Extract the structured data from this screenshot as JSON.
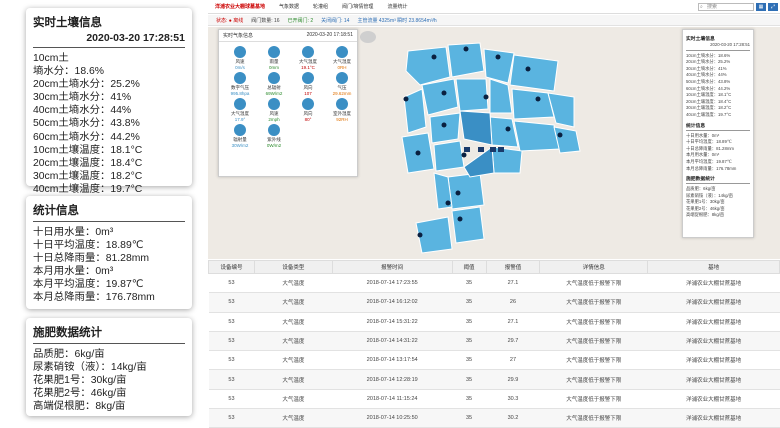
{
  "soil_panel": {
    "title": "实时土壤信息",
    "datetime": "2020-03-20 17:28:51",
    "rows": [
      "10cm土",
      "墒水分：18.6%",
      "20cm土墒水分：25.2%",
      "30cm土墒水分：41%",
      "40cm土墒水分：44%",
      "50cm土墒水分：43.8%",
      "60cm土墒水分：44.2%",
      "10cm土壤温度：18.1°C",
      "20cm土壤温度：18.4°C",
      "30cm土壤温度：18.2°C",
      "40cm土壤温度：19.7°C"
    ]
  },
  "stats_panel": {
    "title": "统计信息",
    "rows": [
      "十日用水量：0m³",
      "十日平均温度：18.89℃",
      "十日总降雨量：81.28mm",
      "本月用水量：0m³",
      "本月平均温度：19.87℃",
      "本月总降雨量：176.78mm"
    ]
  },
  "fert_panel": {
    "title": "施肥数据统计",
    "rows": [
      "品质肥：6kg/亩",
      "尿素硝铵（液）：14kg/亩",
      "花果肥1号：30kg/亩",
      "花果肥2号：46kg/亩",
      "高端促根肥：8kg/亩"
    ]
  },
  "nav": {
    "items": [
      "洋浦农业大棚球墓基地",
      "气象数据",
      "轮灌组",
      "阀门/墒情管理",
      "流量统计"
    ],
    "search_placeholder": "搜索"
  },
  "statusbar": {
    "items": [
      "状态: ● 离线",
      "阀门数量: 16",
      "已开阀门: 2",
      "关闭阀门: 14",
      "主管流量 4325m³ 瞬时 23.8654m³/h"
    ]
  },
  "weather": {
    "title": "实时气象信息",
    "datetime": "2020-03-20 17:18:51",
    "items": [
      {
        "name": "风速",
        "value": "0m/s"
      },
      {
        "name": "雨量",
        "value": "0mm"
      },
      {
        "name": "大气温度",
        "value": "19.1°C"
      },
      {
        "name": "大气湿度",
        "value": "0RH"
      },
      {
        "name": "数字气压",
        "value": "995.8hpa"
      },
      {
        "name": "总辐射",
        "value": "69W/m2"
      },
      {
        "name": "风向",
        "value": "107"
      },
      {
        "name": "气压",
        "value": "29.62mm"
      },
      {
        "name": "大气温度",
        "value": "17.9°"
      },
      {
        "name": "风速",
        "value": "2mph"
      },
      {
        "name": "风向",
        "value": "80°"
      },
      {
        "name": "室外湿度",
        "value": "92RH"
      },
      {
        "name": "辐射量",
        "value": "30W/m2"
      },
      {
        "name": "紫外线",
        "value": "0W/m2"
      }
    ]
  },
  "right_panel": {
    "soil_title": "实时土壤信息",
    "soil_date": "2020-03-20 17:28:51",
    "soil_rows": [
      "10cm土墒水分：18.6%",
      "20cm土墒水分：25.2%",
      "30cm土墒水分：41%",
      "40cm土墒水分：44%",
      "50cm土墒水分：43.8%",
      "60cm土墒水分：44.2%",
      "10cm土壤温度：18.1°C",
      "20cm土壤温度：18.4°C",
      "30cm土壤温度：18.2°C",
      "40cm土壤温度：19.7°C"
    ],
    "stats_title": "统计信息",
    "stats_rows": [
      "十日用水量：0m³",
      "十日平均温度：18.89℃",
      "十日总降雨量：81.28mm",
      "本月用水量：0m³",
      "本月平均温度：19.87℃",
      "本月总降雨量：176.78mm"
    ],
    "fert_title": "施肥数据统计",
    "fert_rows": [
      "品质肥：6kg/亩",
      "尿素硝铵（液）：14kg/亩",
      "花果肥1号：30kg/亩",
      "花果肥2号：46kg/亩",
      "高端促根肥：8kg/亩"
    ]
  },
  "table": {
    "headers": [
      "设备编号",
      "设备类型",
      "报警时间",
      "阈值",
      "报警值",
      "详情信息",
      "基地"
    ],
    "rows": [
      [
        "53",
        "大气温度",
        "2018-07-14 17:23:55",
        "35",
        "27.1",
        "大气温度低于报警下限",
        "洋浦农业大棚甘蔗基地"
      ],
      [
        "53",
        "大气温度",
        "2018-07-14 16:12:02",
        "35",
        "26",
        "大气温度低于报警下限",
        "洋浦农业大棚甘蔗基地"
      ],
      [
        "53",
        "大气温度",
        "2018-07-14 15:31:22",
        "35",
        "27.1",
        "大气温度低于报警下限",
        "洋浦农业大棚甘蔗基地"
      ],
      [
        "53",
        "大气温度",
        "2018-07-14 14:31:22",
        "35",
        "29.7",
        "大气温度低于报警下限",
        "洋浦农业大棚甘蔗基地"
      ],
      [
        "53",
        "大气温度",
        "2018-07-14 13:17:54",
        "35",
        "27",
        "大气温度低于报警下限",
        "洋浦农业大棚甘蔗基地"
      ],
      [
        "53",
        "大气温度",
        "2018-07-14 12:28:19",
        "35",
        "29.9",
        "大气温度低于报警下限",
        "洋浦农业大棚甘蔗基地"
      ],
      [
        "53",
        "大气温度",
        "2018-07-14 11:15:24",
        "35",
        "30.3",
        "大气温度低于报警下限",
        "洋浦农业大棚甘蔗基地"
      ],
      [
        "53",
        "大气温度",
        "2018-07-14 10:25:50",
        "35",
        "30.2",
        "大气温度低于报警下限",
        "洋浦农业大棚甘蔗基地"
      ]
    ]
  },
  "colors": {
    "accent": "#2f6fb5",
    "field": "#5ab4e0",
    "field_dark": "#3a8fc5",
    "alert": "#c00000"
  }
}
